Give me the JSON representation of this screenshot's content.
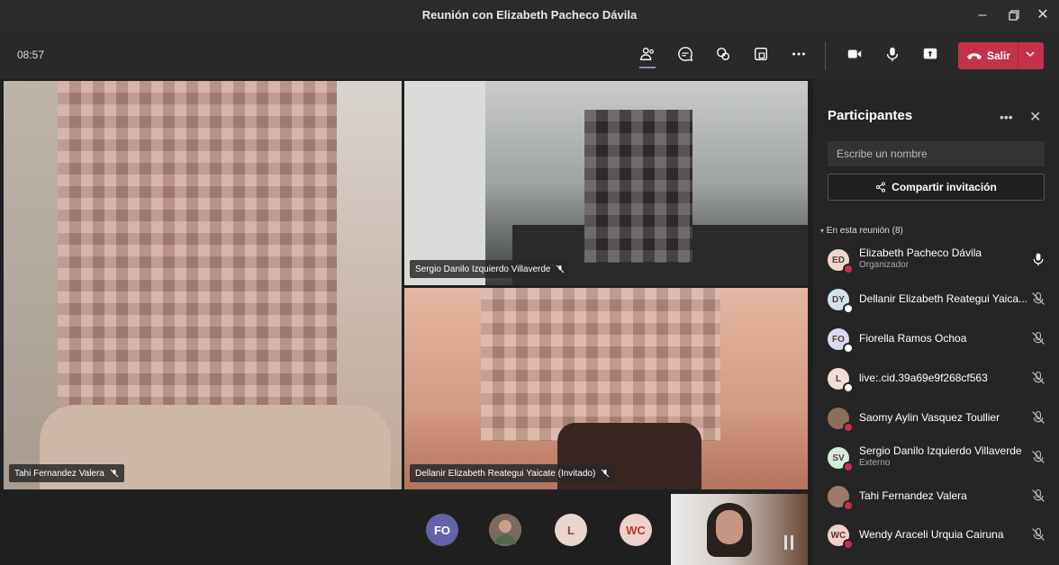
{
  "window": {
    "title": "Reunión con Elizabeth Pacheco Dávila"
  },
  "toolbar": {
    "clock": "08:57",
    "leave_label": "Salir"
  },
  "tiles": [
    {
      "name": "Tahi Fernandez Valera"
    },
    {
      "name": "Sergio Danilo Izquierdo Villaverde"
    },
    {
      "name": "Dellanir Elizabeth Reategui Yaicate (Invitado)"
    }
  ],
  "bottom_avatars": [
    {
      "initials": "FO",
      "color": "#6264a7"
    },
    {
      "initials": "",
      "color": "#8a6f5a"
    },
    {
      "initials": "L",
      "color": "#e8d6cf"
    },
    {
      "initials": "WC",
      "color": "#f0d0cc"
    }
  ],
  "panel": {
    "title": "Participantes",
    "search_placeholder": "Escribe un nombre",
    "share_label": "Compartir invitación",
    "section_label": "En esta reunión (8)",
    "participants": [
      {
        "initials": "ED",
        "name": "Elizabeth Pacheco Dávila",
        "role": "Organizador",
        "mic": "on",
        "avatar_color": "#f0d6cf",
        "status": "red"
      },
      {
        "initials": "DY",
        "name": "Dellanir Elizabeth Reategui Yaica...",
        "role": "",
        "mic": "muted",
        "avatar_color": "#cfe3ef",
        "status": "white"
      },
      {
        "initials": "FO",
        "name": "Fiorella Ramos Ochoa",
        "role": "",
        "mic": "muted",
        "avatar_color": "#d9dbf0",
        "status": "white"
      },
      {
        "initials": "L",
        "name": "live:.cid.39a69e9f268cf563",
        "role": "",
        "mic": "muted",
        "avatar_color": "#f0ddd6",
        "status": "white"
      },
      {
        "initials": "",
        "name": "Saomy Aylin Vasquez Toullier",
        "role": "",
        "mic": "muted",
        "avatar_color": "#8a6f5a",
        "status": "red"
      },
      {
        "initials": "SV",
        "name": "Sergio Danilo Izquierdo Villaverde",
        "role": "Externo",
        "mic": "muted",
        "avatar_color": "#d6ecd8",
        "status": "red"
      },
      {
        "initials": "",
        "name": "Tahi Fernandez Valera",
        "role": "",
        "mic": "muted",
        "avatar_color": "#9a7a6a",
        "status": "red"
      },
      {
        "initials": "WC",
        "name": "Wendy Araceli Urquia Cairuna",
        "role": "",
        "mic": "muted",
        "avatar_color": "#f0d0cc",
        "status": "red"
      }
    ]
  }
}
